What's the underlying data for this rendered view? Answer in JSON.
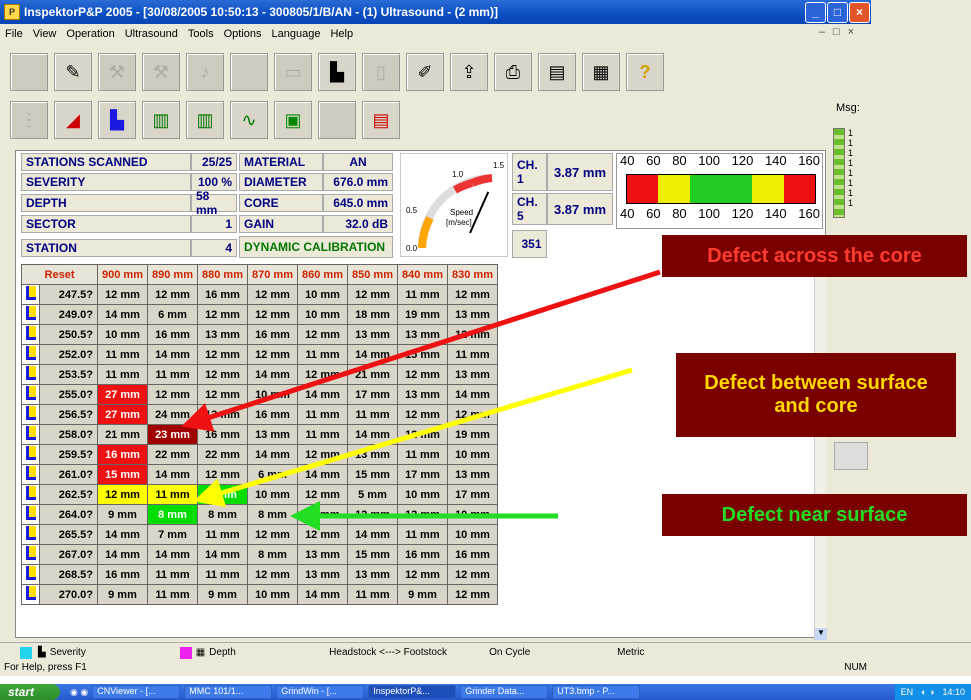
{
  "window": {
    "title": "InspektorP&P 2005 - [30/08/2005 10:50:13 - 300805/1/B/AN - (1) Ultrasound - (2 mm)]"
  },
  "menu": [
    "File",
    "View",
    "Operation",
    "Ultrasound",
    "Tools",
    "Options",
    "Language",
    "Help"
  ],
  "msg": {
    "label": "Msg:",
    "values": [
      "1",
      "1",
      "1",
      "1",
      "1",
      "1",
      "1",
      "1"
    ]
  },
  "info": {
    "stations_scanned_label": "STATIONS SCANNED",
    "stations_scanned": "25/25",
    "severity_label": "SEVERITY",
    "severity": "100 %",
    "depth_label": "DEPTH",
    "depth": "58 mm",
    "sector_label": "SECTOR",
    "sector": "1",
    "station_label": "STATION",
    "station": "4",
    "material_label": "MATERIAL",
    "material": "AN",
    "diameter_label": "DIAMETER",
    "diameter": "676.0 mm",
    "core_label": "CORE",
    "core": "645.0 mm",
    "gain_label": "GAIN",
    "gain": "32.0 dB",
    "calibration": "DYNAMIC CALIBRATION",
    "ch1_label": "CH. 1",
    "ch1": "3.87 mm",
    "ch5_label": "CH. 5",
    "ch5": "3.87 mm",
    "counter": "351"
  },
  "gauge": {
    "ticks": [
      "0.0",
      "0.5",
      "1.0",
      "1.5"
    ],
    "label_top": "Speed",
    "label_bottom": "[m/sec]",
    "value": 1.1
  },
  "scale": {
    "ticks": [
      "40",
      "60",
      "80",
      "100",
      "120",
      "140",
      "160"
    ]
  },
  "grid": {
    "reset": "Reset",
    "columns": [
      "900 mm",
      "890 mm",
      "880 mm",
      "870 mm",
      "860 mm",
      "850 mm",
      "840 mm",
      "830 mm"
    ],
    "rows": [
      {
        "pos": "247.5?",
        "cells": [
          "12 mm",
          "12 mm",
          "16 mm",
          "12 mm",
          "10 mm",
          "12 mm",
          "11 mm",
          "12 mm"
        ]
      },
      {
        "pos": "249.0?",
        "cells": [
          "14 mm",
          "6 mm",
          "12 mm",
          "12 mm",
          "10 mm",
          "18 mm",
          "19 mm",
          "13 mm"
        ]
      },
      {
        "pos": "250.5?",
        "cells": [
          "10 mm",
          "16 mm",
          "13 mm",
          "16 mm",
          "12 mm",
          "13 mm",
          "13 mm",
          "12 mm"
        ]
      },
      {
        "pos": "252.0?",
        "cells": [
          "11 mm",
          "14 mm",
          "12 mm",
          "12 mm",
          "11 mm",
          "14 mm",
          "15 mm",
          "11 mm"
        ]
      },
      {
        "pos": "253.5?",
        "cells": [
          "11 mm",
          "11 mm",
          "12 mm",
          "14 mm",
          "12 mm",
          "21 mm",
          "12 mm",
          "13 mm"
        ]
      },
      {
        "pos": "255.0?",
        "cells": [
          "27 mm",
          "12 mm",
          "12 mm",
          "10 mm",
          "14 mm",
          "17 mm",
          "13 mm",
          "14 mm"
        ]
      },
      {
        "pos": "256.5?",
        "cells": [
          "27 mm",
          "24 mm",
          "13 mm",
          "16 mm",
          "11 mm",
          "11 mm",
          "12 mm",
          "12 mm"
        ]
      },
      {
        "pos": "258.0?",
        "cells": [
          "21 mm",
          "23 mm",
          "16 mm",
          "13 mm",
          "11 mm",
          "14 mm",
          "12 mm",
          "19 mm"
        ]
      },
      {
        "pos": "259.5?",
        "cells": [
          "16 mm",
          "22 mm",
          "22 mm",
          "14 mm",
          "12 mm",
          "13 mm",
          "11 mm",
          "10 mm"
        ]
      },
      {
        "pos": "261.0?",
        "cells": [
          "15 mm",
          "14 mm",
          "12 mm",
          "6 mm",
          "14 mm",
          "15 mm",
          "17 mm",
          "13 mm"
        ]
      },
      {
        "pos": "262.5?",
        "cells": [
          "12 mm",
          "11 mm",
          "8 mm",
          "10 mm",
          "12 mm",
          "5 mm",
          "10 mm",
          "17 mm"
        ]
      },
      {
        "pos": "264.0?",
        "cells": [
          "9 mm",
          "8 mm",
          "8 mm",
          "8 mm",
          "11 mm",
          "12 mm",
          "12 mm",
          "10 mm"
        ]
      },
      {
        "pos": "265.5?",
        "cells": [
          "14 mm",
          "7 mm",
          "11 mm",
          "12 mm",
          "12 mm",
          "14 mm",
          "11 mm",
          "10 mm"
        ]
      },
      {
        "pos": "267.0?",
        "cells": [
          "14 mm",
          "14 mm",
          "14 mm",
          "8 mm",
          "13 mm",
          "15 mm",
          "16 mm",
          "16 mm"
        ]
      },
      {
        "pos": "268.5?",
        "cells": [
          "16 mm",
          "11 mm",
          "11 mm",
          "12 mm",
          "13 mm",
          "13 mm",
          "12 mm",
          "12 mm"
        ]
      },
      {
        "pos": "270.0?",
        "cells": [
          "9 mm",
          "11 mm",
          "9 mm",
          "10 mm",
          "14 mm",
          "11 mm",
          "9 mm",
          "12 mm"
        ]
      }
    ],
    "highlights": {
      "5-0": "red",
      "6-0": "red",
      "7-1": "dred",
      "8-0": "red",
      "9-0": "red",
      "10-0": "yel",
      "10-1": "yel",
      "10-2": "grn",
      "11-1": "grn"
    }
  },
  "callouts": {
    "core": "Defect across the core",
    "between": "Defect between surface and core",
    "near": "Defect near surface",
    "colors": {
      "core_text": "#ff3b2f",
      "between_text": "#ffd800",
      "near_text": "#22dd22",
      "box": "#7a0000"
    }
  },
  "status": {
    "severity": "Severity",
    "depth": "Depth",
    "direction": "Headstock <---> Footstock",
    "cycle": "On Cycle",
    "units": "Metric"
  },
  "help": {
    "text": "For Help, press F1",
    "num": "NUM"
  },
  "taskbar": {
    "start": "start",
    "tasks": [
      "CNViewer - [...",
      "MMC 101/1...",
      "GrindWin - [...",
      "InspektorP&...",
      "Grinder Data...",
      "UT3.bmp - P..."
    ],
    "lang": "EN",
    "clock": "14:10"
  }
}
